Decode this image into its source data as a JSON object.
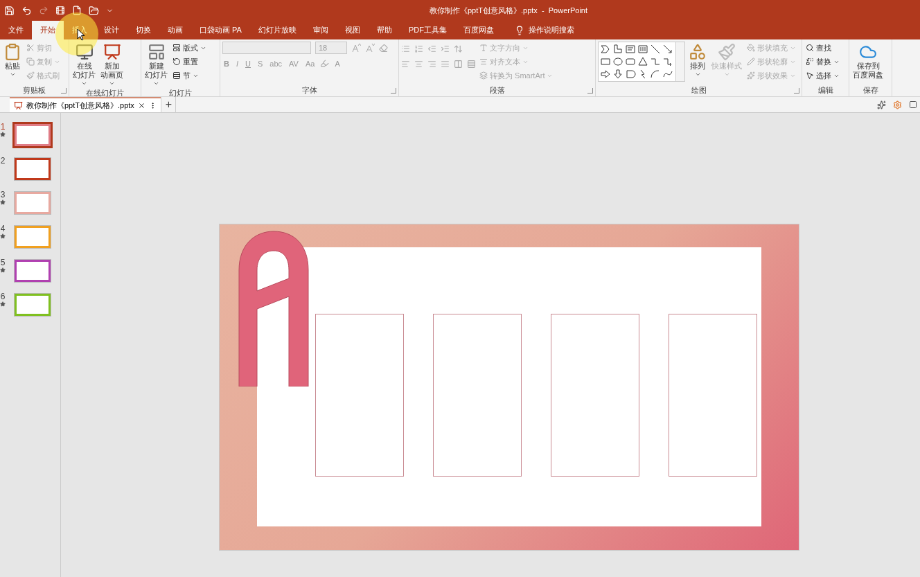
{
  "window": {
    "title": "教你制作《pptT创意风格》.pptx  -  PowerPoint"
  },
  "menu_tabs": [
    {
      "label": "文件",
      "selected": false
    },
    {
      "label": "开始",
      "selected": true
    },
    {
      "label": "插入",
      "selected": false
    },
    {
      "label": "设计",
      "selected": false
    },
    {
      "label": "切换",
      "selected": false
    },
    {
      "label": "动画",
      "selected": false
    },
    {
      "label": "口袋动画 PA",
      "selected": false
    },
    {
      "label": "幻灯片放映",
      "selected": false
    },
    {
      "label": "审阅",
      "selected": false
    },
    {
      "label": "视图",
      "selected": false
    },
    {
      "label": "帮助",
      "selected": false
    },
    {
      "label": "PDF工具集",
      "selected": false
    },
    {
      "label": "百度网盘",
      "selected": false
    }
  ],
  "tell_me": "操作说明搜索",
  "ribbon_groups": [
    {
      "label": "剪贴板",
      "launcher": true,
      "items": [
        {
          "kind": "large",
          "lines": [
            "粘贴"
          ],
          "dropdown": true,
          "disabled": false
        },
        {
          "kind": "small",
          "label": "剪切",
          "dropdown": false,
          "disabled": true
        },
        {
          "kind": "small",
          "label": "复制",
          "dropdown": true,
          "disabled": true
        },
        {
          "kind": "small",
          "label": "格式刷",
          "dropdown": false,
          "disabled": true
        }
      ]
    },
    {
      "label": "在线幻灯片",
      "launcher": false,
      "items": [
        {
          "kind": "large",
          "lines": [
            "在线",
            "幻灯片"
          ],
          "dropdown": true,
          "disabled": false
        },
        {
          "kind": "large",
          "lines": [
            "新加",
            "动画页"
          ],
          "dropdown": true,
          "disabled": false
        }
      ]
    },
    {
      "label": "幻灯片",
      "launcher": false,
      "items": [
        {
          "kind": "large",
          "lines": [
            "新建",
            "幻灯片"
          ],
          "dropdown": true,
          "disabled": false
        },
        {
          "kind": "small",
          "label": "版式",
          "dropdown": true,
          "disabled": false
        },
        {
          "kind": "small",
          "label": "重置",
          "dropdown": false,
          "disabled": false
        },
        {
          "kind": "small",
          "label": "节",
          "dropdown": true,
          "disabled": false
        }
      ]
    },
    {
      "label": "字体",
      "launcher": true,
      "items": [
        {
          "kind": "font_panel",
          "font_size": "18",
          "keys": [
            "B",
            "I",
            "U",
            "S",
            "abc",
            "AV",
            "Aa"
          ],
          "color_key": "A",
          "disabled": true
        }
      ]
    },
    {
      "label": "段落",
      "launcher": true,
      "items": [
        {
          "kind": "paragraph_panel",
          "disabled": true
        },
        {
          "kind": "small",
          "label": "文字方向",
          "dropdown": true,
          "disabled": true
        },
        {
          "kind": "small",
          "label": "对齐文本",
          "dropdown": true,
          "disabled": true
        },
        {
          "kind": "small",
          "label": "转换为 SmartArt",
          "dropdown": true,
          "disabled": true
        }
      ]
    },
    {
      "label": "绘图",
      "launcher": true,
      "items": [
        {
          "kind": "gallery"
        },
        {
          "kind": "large",
          "lines": [
            "排列"
          ],
          "dropdown": true,
          "disabled": false
        },
        {
          "kind": "large",
          "lines": [
            "快速样式"
          ],
          "dropdown": true,
          "disabled": true
        },
        {
          "kind": "small",
          "label": "形状填充",
          "dropdown": true,
          "disabled": true
        },
        {
          "kind": "small",
          "label": "形状轮廓",
          "dropdown": true,
          "disabled": true
        },
        {
          "kind": "small",
          "label": "形状效果",
          "dropdown": true,
          "disabled": true
        }
      ]
    },
    {
      "label": "编辑",
      "launcher": false,
      "items": [
        {
          "kind": "small",
          "label": "查找",
          "dropdown": false,
          "disabled": false
        },
        {
          "kind": "small",
          "label": "替换",
          "dropdown": true,
          "disabled": false
        },
        {
          "kind": "small",
          "label": "选择",
          "dropdown": true,
          "disabled": false
        }
      ]
    },
    {
      "label": "保存",
      "launcher": false,
      "items": [
        {
          "kind": "large",
          "lines": [
            "保存到",
            "百度网盘"
          ],
          "dropdown": false,
          "disabled": false
        }
      ]
    }
  ],
  "doc_tabs": [
    {
      "label": "教你制作《pptT创意风格》.pptx",
      "selected": true
    }
  ],
  "new_tab": "+",
  "thumbnails": [
    {
      "number": "1",
      "selected": true,
      "starred": true,
      "color": "#e07c86"
    },
    {
      "number": "2",
      "selected": false,
      "starred": false,
      "color": "#c0391b"
    },
    {
      "number": "3",
      "selected": false,
      "starred": true,
      "color": "#e8a9a0"
    },
    {
      "number": "4",
      "selected": false,
      "starred": true,
      "color": "#f0a020"
    },
    {
      "number": "5",
      "selected": false,
      "starred": true,
      "color": "#b040b0"
    },
    {
      "number": "6",
      "selected": false,
      "starred": true,
      "color": "#80c020"
    }
  ]
}
